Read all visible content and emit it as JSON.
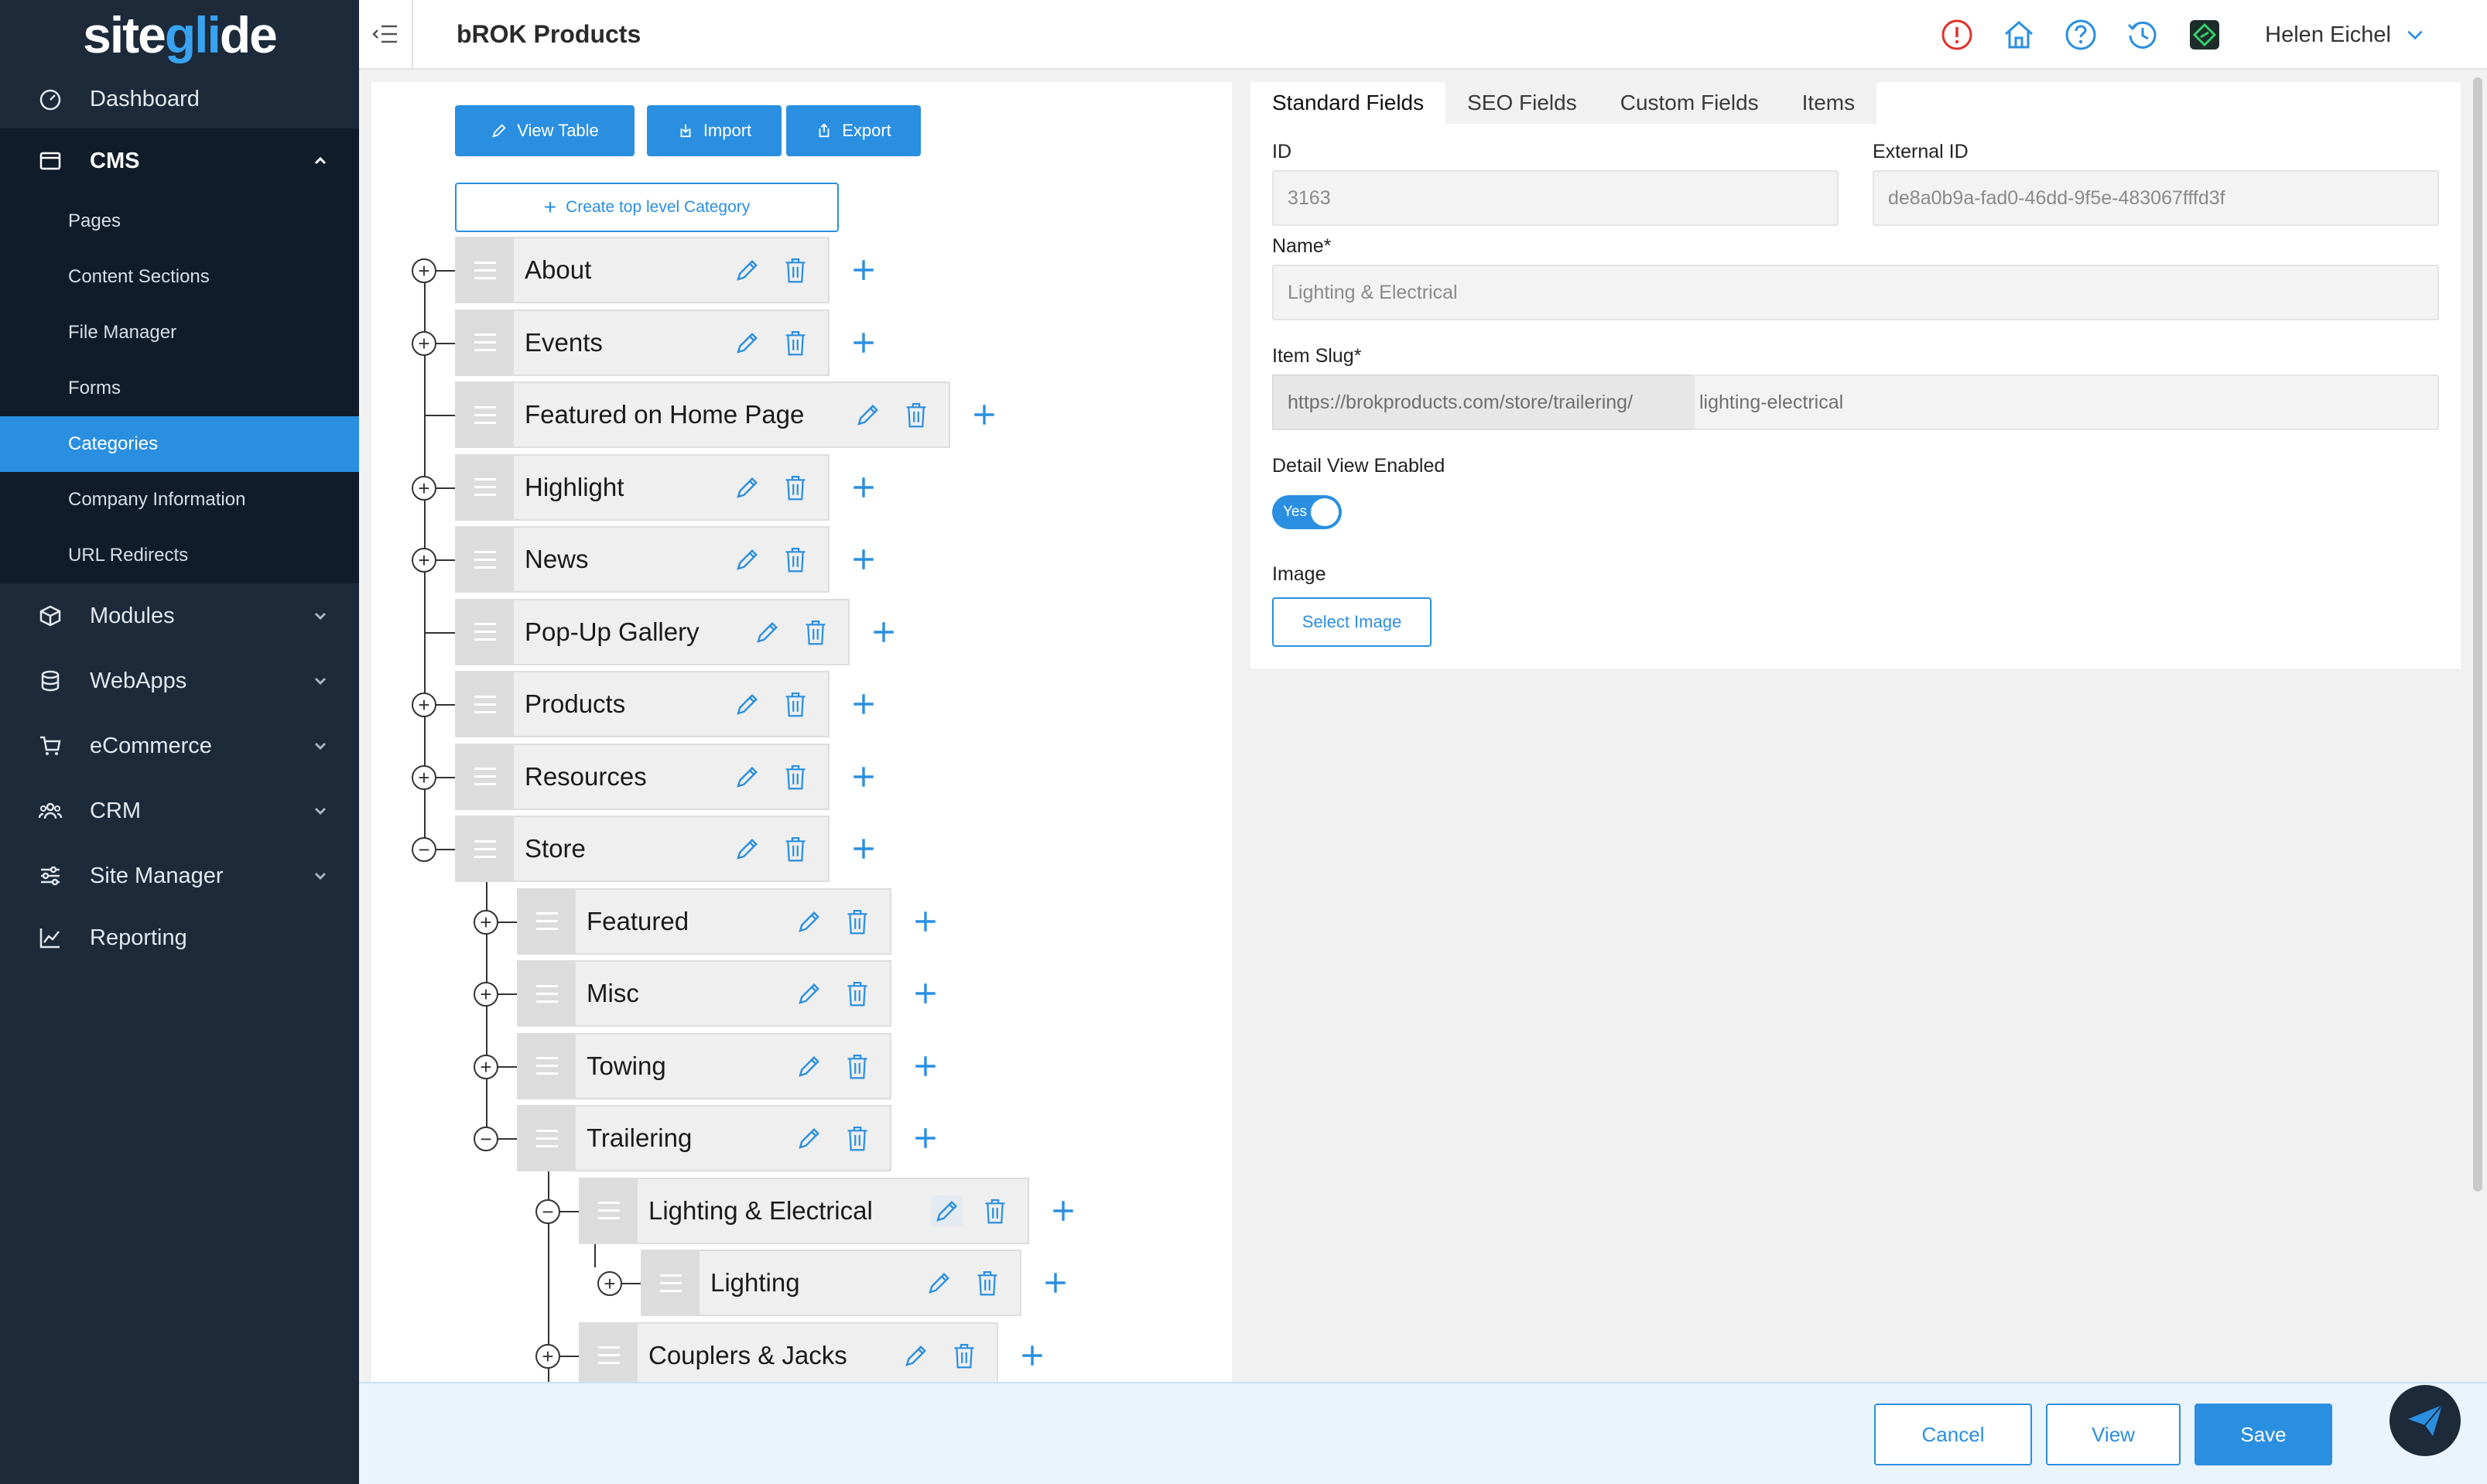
{
  "app": {
    "logo": {
      "prefix": "site",
      "accent": "gli",
      "suffix": "de"
    },
    "title": "bROK Products"
  },
  "sidebar": {
    "items": [
      {
        "label": "Dashboard",
        "icon": "dashboard-icon"
      },
      {
        "label": "CMS",
        "icon": "cms-icon"
      },
      {
        "label": "Modules",
        "icon": "cube-icon"
      },
      {
        "label": "WebApps",
        "icon": "database-icon"
      },
      {
        "label": "eCommerce",
        "icon": "cart-icon"
      },
      {
        "label": "CRM",
        "icon": "users-icon"
      },
      {
        "label": "Site Manager",
        "icon": "sliders-icon"
      },
      {
        "label": "Reporting",
        "icon": "chart-icon"
      }
    ],
    "cms_sub": [
      "Pages",
      "Content Sections",
      "File Manager",
      "Forms",
      "Categories",
      "Company Information",
      "URL Redirects"
    ],
    "active_sub": "Categories"
  },
  "topbar": {
    "user_name": "Helen Eichel"
  },
  "toolbar": {
    "view_table": "View Table",
    "import": "Import",
    "export": "Export",
    "create_category": "Create top level Category"
  },
  "tree": {
    "nodes": [
      "About",
      "Events",
      "Featured on Home Page",
      "Highlight",
      "News",
      "Pop-Up Gallery",
      "Products",
      "Resources",
      "Store",
      "Featured",
      "Misc",
      "Towing",
      "Trailering",
      "Lighting & Electrical",
      "Lighting",
      "Couplers & Jacks"
    ]
  },
  "form": {
    "tabs": [
      "Standard Fields",
      "SEO Fields",
      "Custom Fields",
      "Items"
    ],
    "id_label": "ID",
    "id_value": "3163",
    "external_id_label": "External ID",
    "external_id_value": "de8a0b9a-fad0-46dd-9f5e-483067fffd3f",
    "name_label": "Name*",
    "name_value": "Lighting & Electrical",
    "slug_label": "Item Slug*",
    "slug_prefix": "https://brokproducts.com/store/trailering/",
    "slug_value": "lighting-electrical",
    "detail_label": "Detail View Enabled",
    "detail_value": "Yes",
    "image_label": "Image",
    "select_image": "Select Image"
  },
  "footer": {
    "cancel": "Cancel",
    "view": "View",
    "save": "Save"
  },
  "colors": {
    "accent": "#2a8fe0",
    "sidebar": "#1c2a3a",
    "alert": "#e0302b"
  }
}
